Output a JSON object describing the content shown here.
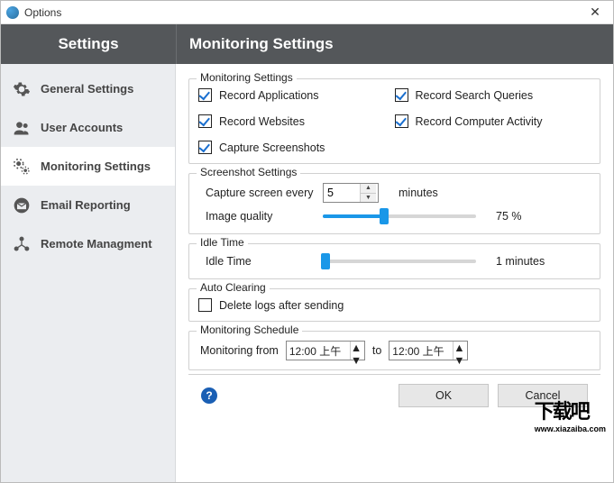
{
  "window": {
    "title": "Options"
  },
  "header": {
    "left": "Settings",
    "right": "Monitoring Settings"
  },
  "sidebar": {
    "items": [
      {
        "label": "General Settings"
      },
      {
        "label": "User Accounts"
      },
      {
        "label": "Monitoring Settings"
      },
      {
        "label": "Email Reporting"
      },
      {
        "label": "Remote Managment"
      }
    ]
  },
  "groups": {
    "monitoring": {
      "legend": "Monitoring Settings",
      "record_apps": "Record Applications",
      "record_sites": "Record Websites",
      "capture_ss": "Capture Screenshots",
      "record_search": "Record Search Queries",
      "record_activity": "Record Computer Activity"
    },
    "screenshot": {
      "legend": "Screenshot Settings",
      "capture_label": "Capture screen every",
      "capture_value": "5",
      "capture_unit": "minutes",
      "quality_label": "Image quality",
      "quality_value": "75 %",
      "quality_pct": 75
    },
    "idle": {
      "legend": "Idle Time",
      "label": "Idle Time",
      "value": "1 minutes",
      "pct": 2
    },
    "clear": {
      "legend": "Auto Clearing",
      "delete_logs": "Delete logs after sending"
    },
    "schedule": {
      "legend": "Monitoring Schedule",
      "from_label": "Monitoring from",
      "from_value": "12:00 上午",
      "to_label": "to",
      "to_value": "12:00 上午"
    }
  },
  "footer": {
    "ok": "OK",
    "cancel": "Cancel"
  },
  "watermark": {
    "big": "下载吧",
    "sub": "www.xiazaiba.com"
  }
}
